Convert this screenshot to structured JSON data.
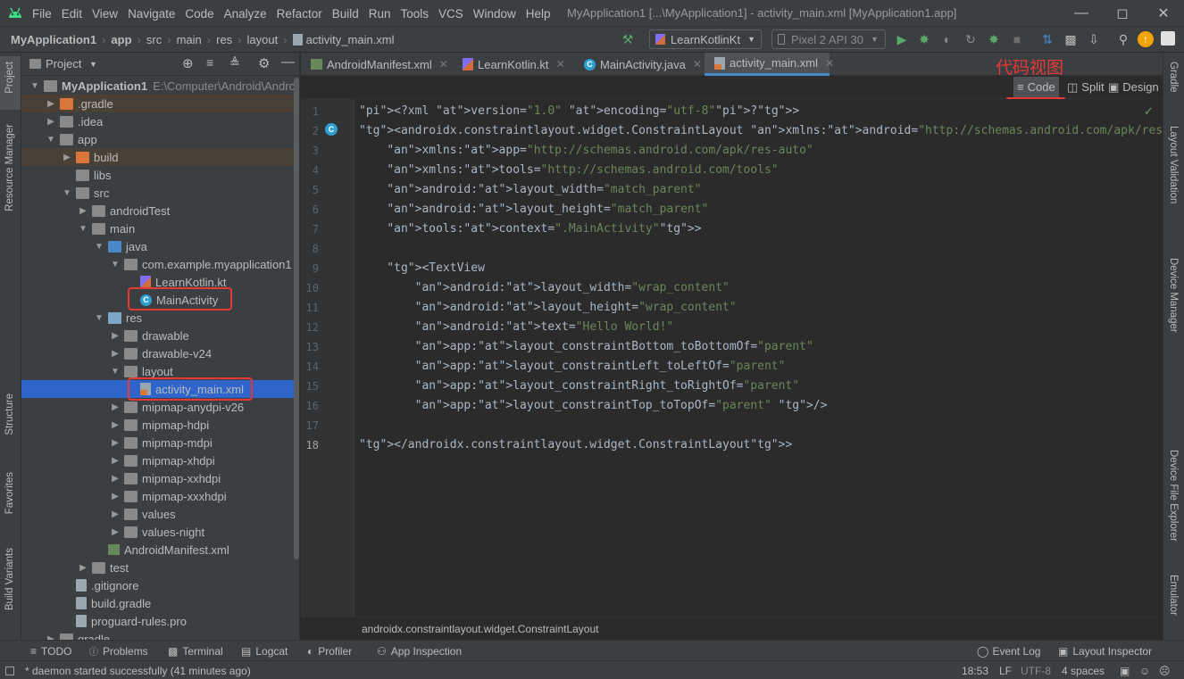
{
  "titlebar": {
    "menu": [
      "File",
      "Edit",
      "View",
      "Navigate",
      "Code",
      "Analyze",
      "Refactor",
      "Build",
      "Run",
      "Tools",
      "VCS",
      "Window",
      "Help"
    ],
    "title": "MyApplication1 [...\\MyApplication1] - activity_main.xml [MyApplication1.app]"
  },
  "navbar": {
    "breadcrumbs": [
      "MyApplication1",
      "app",
      "src",
      "main",
      "res",
      "layout",
      "activity_main.xml"
    ],
    "run_config": "LearnKotlinKt",
    "device": "Pixel 2 API 30"
  },
  "left_strip": {
    "project": "Project",
    "resource_manager": "Resource Manager",
    "structure": "Structure",
    "favorites": "Favorites",
    "build_variants": "Build Variants"
  },
  "right_strip": {
    "gradle": "Gradle",
    "layout_validation": "Layout Validation",
    "device_manager": "Device Manager",
    "device_file_explorer": "Device File Explorer",
    "emulator": "Emulator"
  },
  "project_panel": {
    "title": "Project",
    "items": [
      {
        "label": "MyApplication1",
        "extra": "E:\\Computer\\Android\\Androi",
        "depth": 0,
        "arrow": "▼",
        "icon": "folder"
      },
      {
        "label": ".gradle",
        "depth": 1,
        "arrow": "▶",
        "icon": "folder-orange"
      },
      {
        "label": ".idea",
        "depth": 1,
        "arrow": "▶",
        "icon": "folder"
      },
      {
        "label": "app",
        "depth": 1,
        "arrow": "▼",
        "icon": "folder"
      },
      {
        "label": "build",
        "depth": 2,
        "arrow": "▶",
        "icon": "folder-orange"
      },
      {
        "label": "libs",
        "depth": 2,
        "arrow": "",
        "icon": "folder"
      },
      {
        "label": "src",
        "depth": 2,
        "arrow": "▼",
        "icon": "folder"
      },
      {
        "label": "androidTest",
        "depth": 3,
        "arrow": "▶",
        "icon": "folder"
      },
      {
        "label": "main",
        "depth": 3,
        "arrow": "▼",
        "icon": "folder"
      },
      {
        "label": "java",
        "depth": 4,
        "arrow": "▼",
        "icon": "folder-blue"
      },
      {
        "label": "com.example.myapplication1",
        "depth": 5,
        "arrow": "▼",
        "icon": "folder"
      },
      {
        "label": "LearnKotlin.kt",
        "depth": 6,
        "arrow": "",
        "icon": "kotlin"
      },
      {
        "label": "MainActivity",
        "depth": 6,
        "arrow": "",
        "icon": "class"
      },
      {
        "label": "res",
        "depth": 4,
        "arrow": "▼",
        "icon": "folder-src"
      },
      {
        "label": "drawable",
        "depth": 5,
        "arrow": "▶",
        "icon": "folder"
      },
      {
        "label": "drawable-v24",
        "depth": 5,
        "arrow": "▶",
        "icon": "folder"
      },
      {
        "label": "layout",
        "depth": 5,
        "arrow": "▼",
        "icon": "folder"
      },
      {
        "label": "activity_main.xml",
        "depth": 6,
        "arrow": "",
        "icon": "xml"
      },
      {
        "label": "mipmap-anydpi-v26",
        "depth": 5,
        "arrow": "▶",
        "icon": "folder"
      },
      {
        "label": "mipmap-hdpi",
        "depth": 5,
        "arrow": "▶",
        "icon": "folder"
      },
      {
        "label": "mipmap-mdpi",
        "depth": 5,
        "arrow": "▶",
        "icon": "folder"
      },
      {
        "label": "mipmap-xhdpi",
        "depth": 5,
        "arrow": "▶",
        "icon": "folder"
      },
      {
        "label": "mipmap-xxhdpi",
        "depth": 5,
        "arrow": "▶",
        "icon": "folder"
      },
      {
        "label": "mipmap-xxxhdpi",
        "depth": 5,
        "arrow": "▶",
        "icon": "folder"
      },
      {
        "label": "values",
        "depth": 5,
        "arrow": "▶",
        "icon": "folder"
      },
      {
        "label": "values-night",
        "depth": 5,
        "arrow": "▶",
        "icon": "folder"
      },
      {
        "label": "AndroidManifest.xml",
        "depth": 4,
        "arrow": "",
        "icon": "manifest"
      },
      {
        "label": "test",
        "depth": 3,
        "arrow": "▶",
        "icon": "folder"
      },
      {
        "label": ".gitignore",
        "depth": 2,
        "arrow": "",
        "icon": "file"
      },
      {
        "label": "build.gradle",
        "depth": 2,
        "arrow": "",
        "icon": "file"
      },
      {
        "label": "proguard-rules.pro",
        "depth": 2,
        "arrow": "",
        "icon": "file"
      },
      {
        "label": "gradle",
        "depth": 1,
        "arrow": "▶",
        "icon": "folder"
      }
    ],
    "selected_label": "activity_main.xml"
  },
  "tabs": [
    {
      "label": "AndroidManifest.xml",
      "icon": "manifest"
    },
    {
      "label": "LearnKotlin.kt",
      "icon": "kotlin"
    },
    {
      "label": "MainActivity.java",
      "icon": "class"
    },
    {
      "label": "activity_main.xml",
      "icon": "xml",
      "active": true
    }
  ],
  "editor_toolbar": {
    "annotation": "代码视图",
    "code": "Code",
    "split": "Split",
    "design": "Design"
  },
  "code_lines": [
    {
      "n": "1",
      "text": "<?xml version=\"1.0\" encoding=\"utf-8\"?>"
    },
    {
      "n": "2",
      "text": "<androidx.constraintlayout.widget.ConstraintLayout xmlns:android=\"http://schemas.android.com/apk/res/android\""
    },
    {
      "n": "3",
      "text": "    xmlns:app=\"http://schemas.android.com/apk/res-auto\""
    },
    {
      "n": "4",
      "text": "    xmlns:tools=\"http://schemas.android.com/tools\""
    },
    {
      "n": "5",
      "text": "    android:layout_width=\"match_parent\""
    },
    {
      "n": "6",
      "text": "    android:layout_height=\"match_parent\""
    },
    {
      "n": "7",
      "text": "    tools:context=\".MainActivity\">"
    },
    {
      "n": "8",
      "text": ""
    },
    {
      "n": "9",
      "text": "    <TextView"
    },
    {
      "n": "10",
      "text": "        android:layout_width=\"wrap_content\""
    },
    {
      "n": "11",
      "text": "        android:layout_height=\"wrap_content\""
    },
    {
      "n": "12",
      "text": "        android:text=\"Hello World!\""
    },
    {
      "n": "13",
      "text": "        app:layout_constraintBottom_toBottomOf=\"parent\""
    },
    {
      "n": "14",
      "text": "        app:layout_constraintLeft_toLeftOf=\"parent\""
    },
    {
      "n": "15",
      "text": "        app:layout_constraintRight_toRightOf=\"parent\""
    },
    {
      "n": "16",
      "text": "        app:layout_constraintTop_toTopOf=\"parent\" />"
    },
    {
      "n": "17",
      "text": ""
    },
    {
      "n": "18",
      "text": "</androidx.constraintlayout.widget.ConstraintLayout>"
    }
  ],
  "editor_breadcrumb": "androidx.constraintlayout.widget.ConstraintLayout",
  "tool_windows": {
    "todo": "TODO",
    "problems": "Problems",
    "terminal": "Terminal",
    "logcat": "Logcat",
    "profiler": "Profiler",
    "app_inspection": "App Inspection",
    "event_log": "Event Log",
    "layout_inspector": "Layout Inspector"
  },
  "status": {
    "message": "* daemon started successfully (41 minutes ago)",
    "position": "18:53",
    "line_sep": "LF",
    "encoding": "UTF-8",
    "indent": "4 spaces"
  },
  "colors": {
    "accent": "#4a88c7",
    "annotation_red": "#e53935",
    "bg": "#2b2b2b",
    "panel": "#3c3f41"
  }
}
